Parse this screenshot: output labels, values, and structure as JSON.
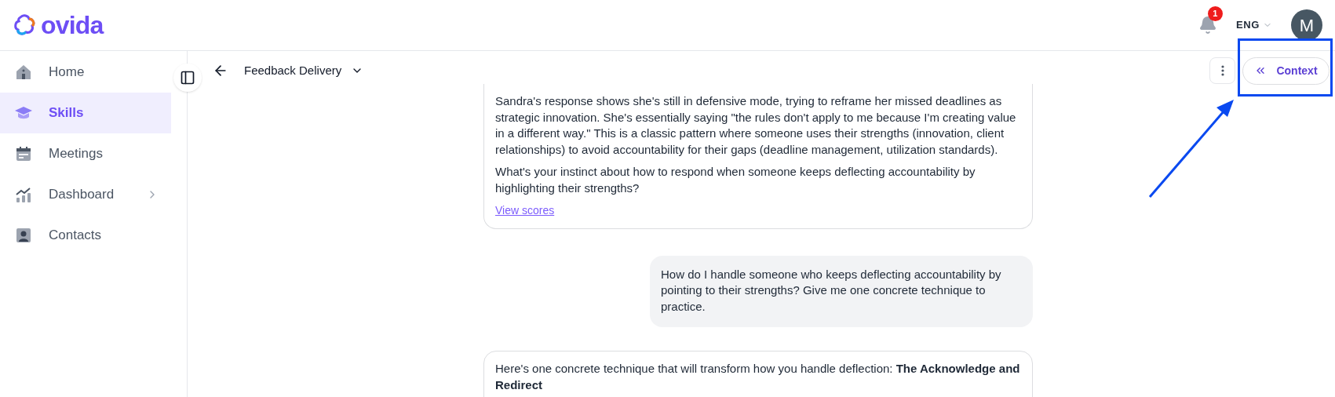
{
  "header": {
    "logo": "ovida",
    "notifications": "1",
    "language": "ENG",
    "avatar": "M"
  },
  "sidebar": {
    "items": [
      {
        "label": "Home",
        "selected": false,
        "expandable": false
      },
      {
        "label": "Skills",
        "selected": true,
        "expandable": false
      },
      {
        "label": "Meetings",
        "selected": false,
        "expandable": false
      },
      {
        "label": "Dashboard",
        "selected": false,
        "expandable": true
      },
      {
        "label": "Contacts",
        "selected": false,
        "expandable": false
      }
    ]
  },
  "toolbar": {
    "title": "Feedback Delivery",
    "context_button": "Context"
  },
  "messages": [
    {
      "kind": "assistant",
      "paragraphs": [
        "Sandra's response shows she's still in defensive mode, trying to reframe her missed deadlines as strategic innovation. She's essentially saying \"the rules don't apply to me because I'm creating value in a different way.\" This is a classic pattern where someone uses their strengths (innovation, client relationships) to avoid accountability for their gaps (deadline management, utilization standards).",
        "What's your instinct about how to respond when someone keeps deflecting accountability by highlighting their strengths?"
      ],
      "link": "View scores"
    },
    {
      "kind": "user",
      "paragraphs": [
        "How do I handle someone who keeps deflecting accountability by pointing to their strengths? Give me one concrete technique to practice."
      ]
    },
    {
      "kind": "assistant",
      "paragraphs": [
        "Here's one concrete technique that will transform how you handle deflection: **The Acknowledge and Redirect**"
      ]
    }
  ]
}
